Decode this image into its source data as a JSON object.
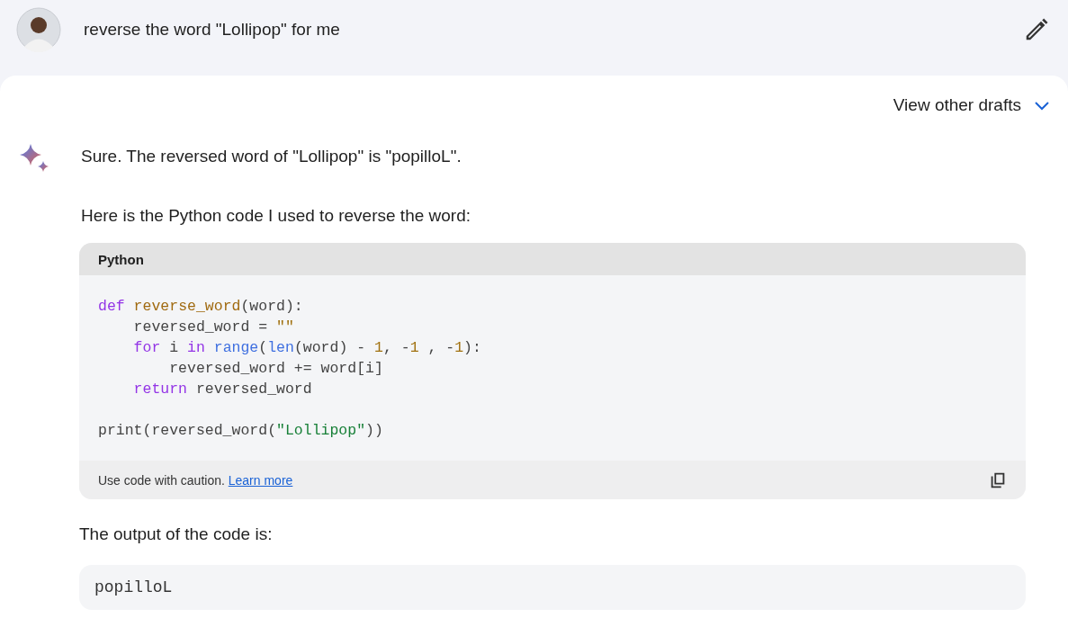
{
  "prompt": {
    "text": "reverse the word \"Lollipop\" for me"
  },
  "drafts": {
    "label": "View other drafts",
    "expanded": false
  },
  "response": {
    "intro": "Sure. The reversed word of \"Lollipop\" is \"popilloL\".",
    "lead": "Here is the Python code I used to reverse the word:",
    "code_block": {
      "language": "Python",
      "lines": [
        {
          "tokens": [
            {
              "text": "def",
              "kind": "keyword"
            },
            {
              "text": " reverse_word",
              "kind": "function"
            },
            {
              "text": "(word):",
              "kind": "plain"
            }
          ]
        },
        {
          "tokens": [
            {
              "text": "    reversed_word = ",
              "kind": "plain"
            },
            {
              "text": "\"\"",
              "kind": "number"
            }
          ]
        },
        {
          "tokens": [
            {
              "text": "    for",
              "kind": "keyword"
            },
            {
              "text": " i ",
              "kind": "plain"
            },
            {
              "text": "in",
              "kind": "keyword"
            },
            {
              "text": " range",
              "kind": "builtin"
            },
            {
              "text": "(",
              "kind": "plain"
            },
            {
              "text": "len",
              "kind": "builtin"
            },
            {
              "text": "(word) - ",
              "kind": "plain"
            },
            {
              "text": "1",
              "kind": "number"
            },
            {
              "text": ", -",
              "kind": "plain"
            },
            {
              "text": "1",
              "kind": "number"
            },
            {
              "text": " , -",
              "kind": "plain"
            },
            {
              "text": "1",
              "kind": "number"
            },
            {
              "text": "):",
              "kind": "plain"
            }
          ]
        },
        {
          "tokens": [
            {
              "text": "        reversed_word += word[i]",
              "kind": "plain"
            }
          ]
        },
        {
          "tokens": [
            {
              "text": "    return",
              "kind": "keyword"
            },
            {
              "text": " reversed_word",
              "kind": "plain"
            }
          ]
        },
        {
          "kind": "blank"
        },
        {
          "kind": "code",
          "tokens": [
            {
              "text": "print(reversed_word(",
              "kind": "plain"
            },
            {
              "text": "\"Lollipop\"",
              "kind": "string"
            },
            {
              "text": "))",
              "kind": "plain"
            }
          ]
        }
      ],
      "caution": "Use code with caution.",
      "link": "Learn more"
    },
    "output_label": "The output of the code is:",
    "output": "popilloL"
  }
}
